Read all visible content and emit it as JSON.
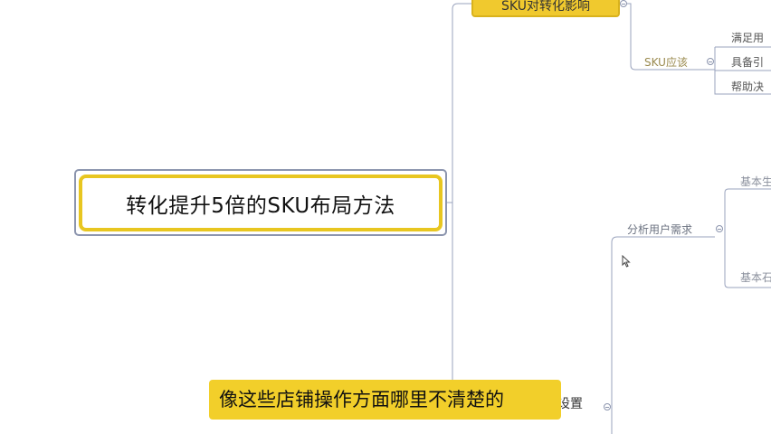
{
  "mindmap": {
    "root": "转化提升5倍的SKU布局方法",
    "branch_top": "SKU对转化影响",
    "sku_should": "SKU应该",
    "sku_leaves": [
      "满足用",
      "具备引",
      "帮助决"
    ],
    "analyze_needs": "分析用户需求",
    "basic_top": "基本生",
    "basic_bottom": "基本石",
    "bottom_node_partial": "设置"
  },
  "subtitle": {
    "text": "像这些店铺操作方面哪里不清楚的"
  },
  "colors": {
    "root_border": "#e8c620",
    "branch_fill": "#f0c92e",
    "subtitle_bg": "#f2cf2a",
    "connector": "#9aa3bd"
  },
  "icons": {
    "cursor": "arrow-cursor-icon",
    "collapse": "collapse-toggle-icon"
  }
}
